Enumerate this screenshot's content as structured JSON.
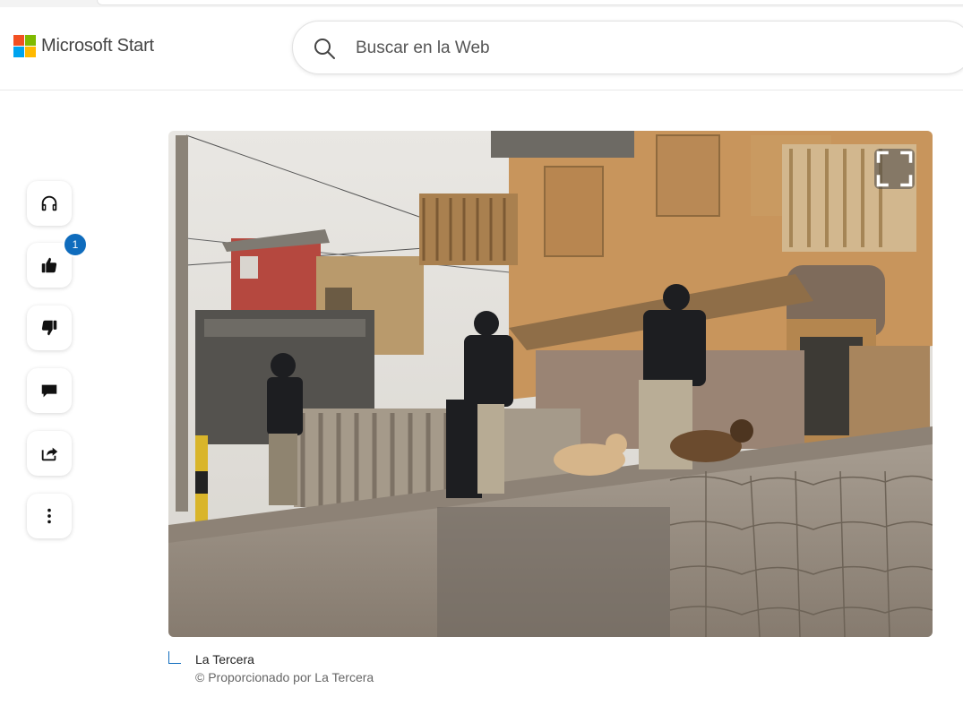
{
  "header": {
    "brand": "Microsoft Start",
    "search_placeholder": "Buscar en la Web"
  },
  "rail": {
    "like_count": "1"
  },
  "image_caption": {
    "source": "La Tercera",
    "credit": "© Proporcionado por La Tercera"
  },
  "colors": {
    "accent": "#0f6cbd",
    "logo_red": "#f25022",
    "logo_green": "#7fba00",
    "logo_blue": "#00a4ef",
    "logo_yellow": "#ffb900"
  },
  "icons": [
    "search-icon",
    "headphones-icon",
    "thumbs-up-icon",
    "thumbs-down-icon",
    "comment-icon",
    "share-icon",
    "more-vertical-icon",
    "expand-icon"
  ]
}
